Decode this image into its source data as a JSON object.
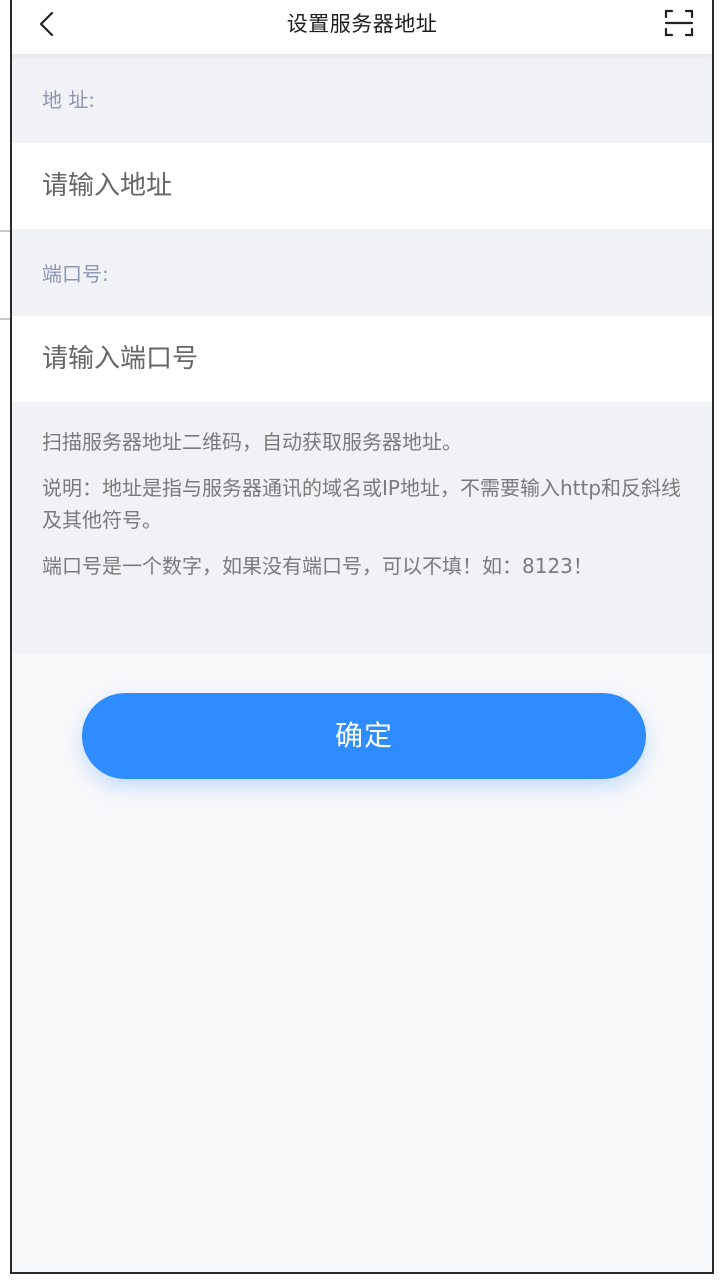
{
  "header": {
    "title": "设置服务器地址",
    "back_icon": "chevron-left-icon",
    "scan_icon": "scan-icon"
  },
  "form": {
    "address_label": "地 址:",
    "address_placeholder": "请输入地址",
    "address_value": "",
    "port_label": "端口号:",
    "port_placeholder": "请输入端口号",
    "port_value": ""
  },
  "notes": {
    "line1": "扫描服务器地址二维码，自动获取服务器地址。",
    "line2": "说明：地址是指与服务器通讯的域名或IP地址，不需要输入http和反斜线及其他符号。",
    "line3": "端口号是一个数字，如果没有端口号，可以不填！如：8123！"
  },
  "actions": {
    "confirm_label": "确定"
  },
  "colors": {
    "accent": "#2f8cff",
    "label_text": "#8a96b3",
    "band_bg": "#f1f2f6"
  }
}
